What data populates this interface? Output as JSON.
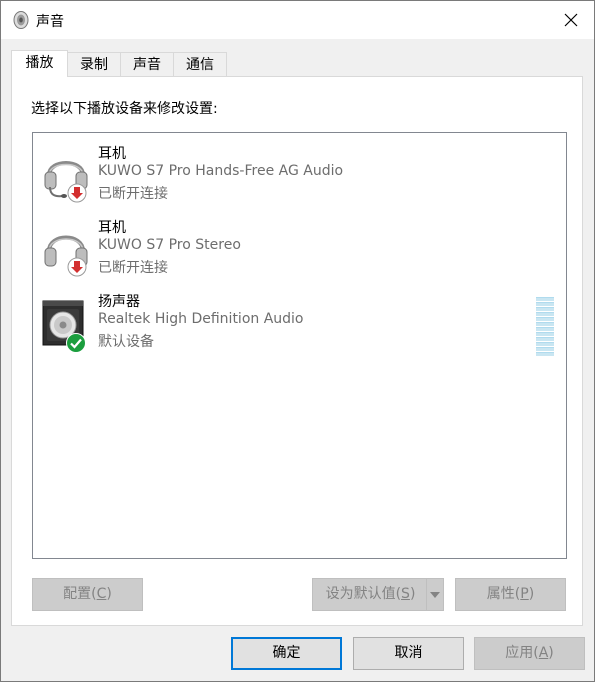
{
  "window": {
    "title": "声音"
  },
  "tabs": [
    {
      "label": "播放",
      "active": true
    },
    {
      "label": "录制",
      "active": false
    },
    {
      "label": "声音",
      "active": false
    },
    {
      "label": "通信",
      "active": false
    }
  ],
  "panel": {
    "instruction": "选择以下播放设备来修改设置:"
  },
  "devices": [
    {
      "name": "耳机",
      "description": "KUWO S7 Pro Hands-Free AG Audio",
      "status": "已断开连接",
      "icon": "headset-icon",
      "badge": "disconnected-badge"
    },
    {
      "name": "耳机",
      "description": "KUWO S7 Pro Stereo",
      "status": "已断开连接",
      "icon": "headphones-icon",
      "badge": "disconnected-badge"
    },
    {
      "name": "扬声器",
      "description": "Realtek High Definition Audio",
      "status": "默认设备",
      "icon": "speaker-icon",
      "badge": "default-check-badge"
    }
  ],
  "panel_buttons": {
    "configure": {
      "label": "配置",
      "accel": "C"
    },
    "set_default": {
      "label": "设为默认值",
      "accel": "S"
    },
    "properties": {
      "label": "属性",
      "accel": "P"
    }
  },
  "dialog_buttons": {
    "ok": "确定",
    "cancel": "取消",
    "apply": {
      "label": "应用",
      "accel": "A"
    }
  },
  "colors": {
    "accent": "#0078d7",
    "disabled_text": "#838383",
    "secondary_text": "#6d6d6d",
    "level_meter": "#c9e6f2"
  }
}
